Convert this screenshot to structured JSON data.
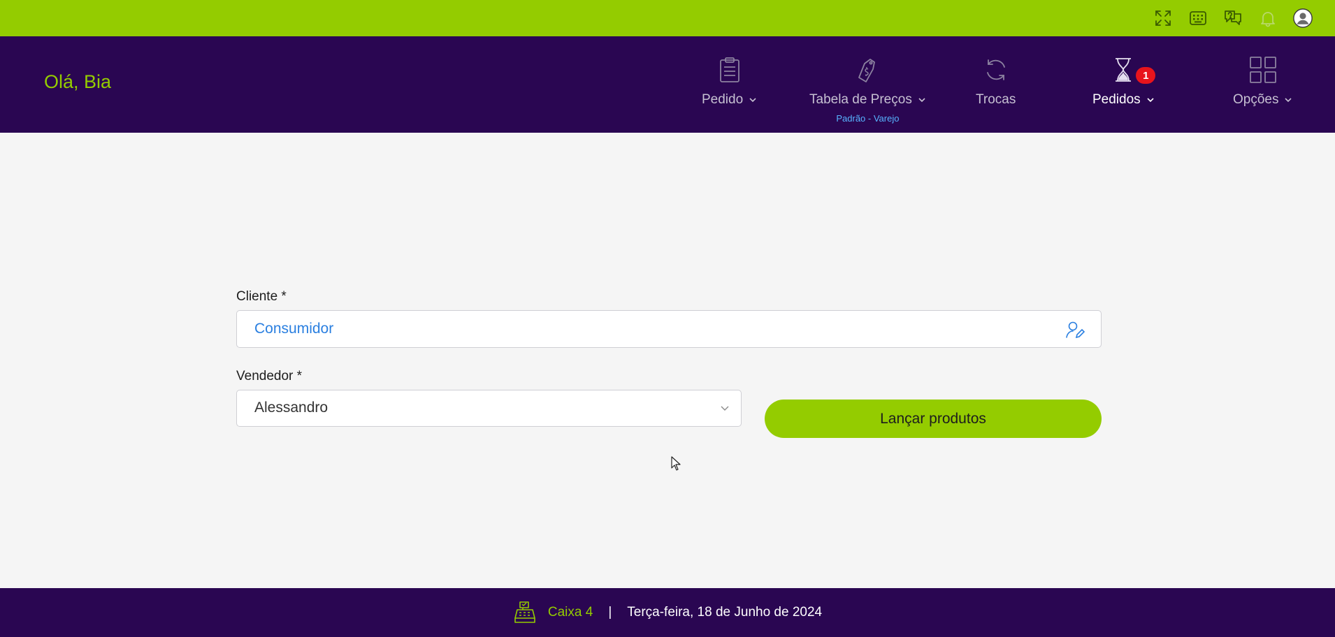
{
  "topbar": {
    "icons": [
      "fullscreen-icon",
      "keyboard-icon",
      "help-icon",
      "bell-icon",
      "user-avatar-icon"
    ]
  },
  "header": {
    "greeting": "Olá, Bia",
    "nav": [
      {
        "label": "Pedido",
        "icon": "clipboard-icon",
        "dropdown": true
      },
      {
        "label": "Tabela de Preços",
        "icon": "price-tag-icon",
        "dropdown": true,
        "sub": "Padrão - Varejo"
      },
      {
        "label": "Trocas",
        "icon": "exchange-icon",
        "dropdown": false
      },
      {
        "label": "Pedidos",
        "icon": "hourglass-icon",
        "dropdown": true,
        "badge": "1",
        "active": true
      },
      {
        "label": "Opções",
        "icon": "grid-icon",
        "dropdown": true
      }
    ]
  },
  "form": {
    "cliente_label": "Cliente *",
    "cliente_value": "Consumidor",
    "vendedor_label": "Vendedor *",
    "vendedor_value": "Alessandro",
    "launch_label": "Lançar produtos"
  },
  "footer": {
    "caixa": "Caixa 4",
    "separator": "|",
    "date": "Terça-feira, 18 de Junho de 2024"
  },
  "colors": {
    "accent": "#94cc00",
    "nav_bg": "#2a0652",
    "link_blue": "#2a7fe0",
    "badge_red": "#e8141c"
  }
}
